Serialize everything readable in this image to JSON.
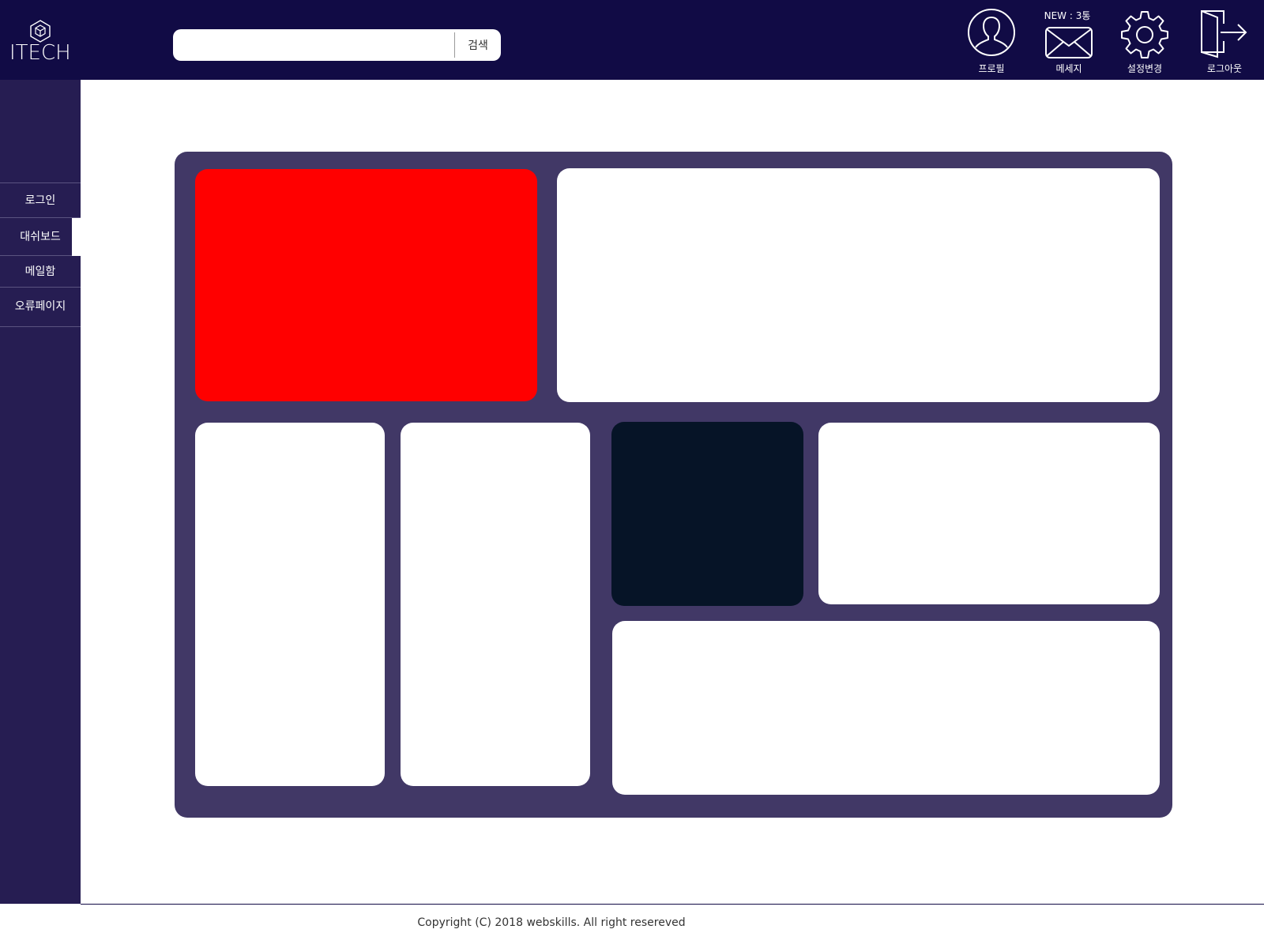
{
  "brand": {
    "logo_text": "ITECH"
  },
  "search": {
    "placeholder": "",
    "value": "",
    "button_label": "검색"
  },
  "top_nav": {
    "profile_label": "프로필",
    "message_label": "메세지",
    "message_badge": "NEW : 3통",
    "settings_label": "설정변경",
    "logout_label": "로그아웃"
  },
  "sidebar": {
    "items": [
      {
        "label": "로그인"
      },
      {
        "label": "대쉬보드",
        "active": true
      },
      {
        "label": "메일함"
      },
      {
        "label": "오류페이지"
      }
    ]
  },
  "dashboard": {
    "card_colors": {
      "accent": "#ff0000",
      "dark": "#061427",
      "panel": "#413866"
    }
  },
  "footer": {
    "copyright": "Copyright (C) 2018 webskills. All right resereved"
  },
  "colors": {
    "header": "#110b45",
    "sidebar": "#261d52"
  }
}
